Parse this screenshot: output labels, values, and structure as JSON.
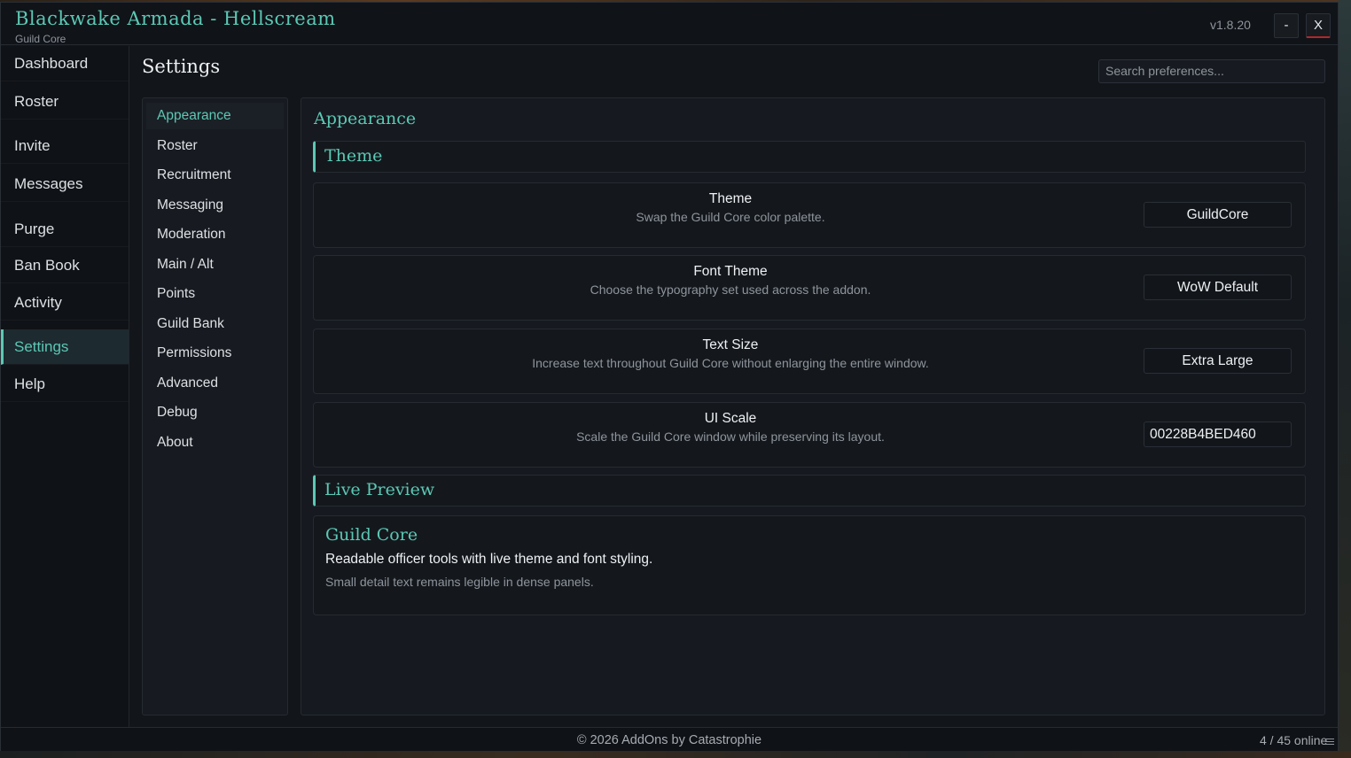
{
  "window": {
    "title": "Blackwake Armada - Hellscream",
    "subtitle": "Guild Core",
    "version": "v1.8.20",
    "minimize_label": "-",
    "close_label": "X"
  },
  "nav": {
    "items": [
      {
        "label": "Dashboard"
      },
      {
        "label": "Roster"
      },
      {
        "label": "Invite"
      },
      {
        "label": "Messages"
      },
      {
        "label": "Purge"
      },
      {
        "label": "Ban Book"
      },
      {
        "label": "Activity"
      },
      {
        "label": "Settings",
        "active": true
      },
      {
        "label": "Help"
      }
    ]
  },
  "page": {
    "title": "Settings",
    "search_placeholder": "Search preferences..."
  },
  "settings_nav": {
    "items": [
      {
        "label": "Appearance",
        "active": true
      },
      {
        "label": "Roster"
      },
      {
        "label": "Recruitment"
      },
      {
        "label": "Messaging"
      },
      {
        "label": "Moderation"
      },
      {
        "label": "Main / Alt"
      },
      {
        "label": "Points"
      },
      {
        "label": "Guild Bank"
      },
      {
        "label": "Permissions"
      },
      {
        "label": "Advanced"
      },
      {
        "label": "Debug"
      },
      {
        "label": "About"
      }
    ]
  },
  "appearance": {
    "title": "Appearance",
    "theme_section": "Theme",
    "rows": [
      {
        "label": "Theme",
        "description": "Swap the Guild Core color palette.",
        "value": "GuildCore"
      },
      {
        "label": "Font Theme",
        "description": "Choose the typography set used across the addon.",
        "value": "WoW Default"
      },
      {
        "label": "Text Size",
        "description": "Increase text throughout Guild Core without enlarging the entire window.",
        "value": "Extra Large"
      },
      {
        "label": "UI Scale",
        "description": "Scale the Guild Core window while preserving its layout.",
        "value": "00228B4BED460"
      }
    ],
    "preview_section": "Live Preview",
    "preview": {
      "title": "Guild Core",
      "body": "Readable officer tools with live theme and font styling.",
      "detail": "Small detail text remains legible in dense panels."
    }
  },
  "footer": {
    "copyright": "© 2026 AddOns by Catastrophie",
    "online": "4 / 45 online"
  },
  "colors": {
    "accent": "#5cc8b4",
    "close_accent": "#b3262a",
    "background": "#12151a"
  }
}
